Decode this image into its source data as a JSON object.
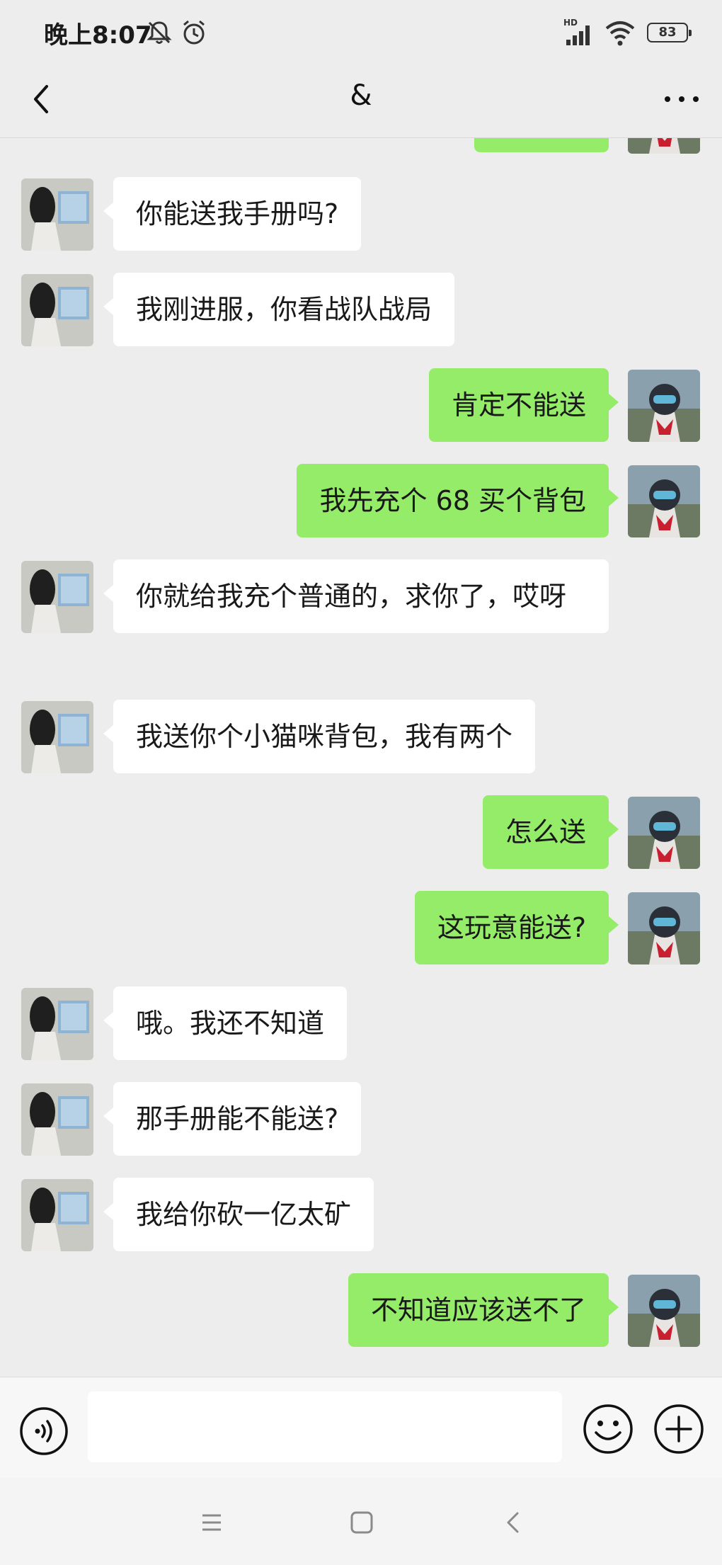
{
  "status_bar": {
    "time": "晚上8:07",
    "left_icons": [
      "mute-bell-icon",
      "alarm-icon"
    ],
    "signal_label": "HD",
    "battery": "83"
  },
  "nav": {
    "title": "&",
    "back_icon": "chevron-left-icon",
    "more_icon": "more-dots-icon"
  },
  "messages": [
    {
      "side": "right",
      "text": ""
    },
    {
      "side": "left",
      "text": "你能送我手册吗?"
    },
    {
      "side": "left",
      "text": "我刚进服，你看战队战局"
    },
    {
      "side": "right",
      "text": "肯定不能送"
    },
    {
      "side": "right",
      "text": "我先充个 68 买个背包"
    },
    {
      "side": "left",
      "text": "你就给我充个普通的，求你了，哎呀"
    },
    {
      "side": "left",
      "text": "我送你个小猫咪背包，我有两个"
    },
    {
      "side": "right",
      "text": "怎么送"
    },
    {
      "side": "right",
      "text": "这玩意能送?"
    },
    {
      "side": "left",
      "text": "哦。我还不知道"
    },
    {
      "side": "left",
      "text": "那手册能不能送?"
    },
    {
      "side": "left",
      "text": "我给你砍一亿太矿"
    },
    {
      "side": "right",
      "text": "不知道应该送不了"
    }
  ],
  "input_bar": {
    "value": "",
    "voice_icon": "voice-icon",
    "emoji_icon": "emoji-icon",
    "plus_icon": "plus-circle-icon"
  },
  "system_nav": [
    "menu-icon",
    "home-square-icon",
    "back-triangle-icon"
  ],
  "colors": {
    "background": "#ededed",
    "self_bubble": "#95ec69",
    "other_bubble": "#ffffff"
  }
}
